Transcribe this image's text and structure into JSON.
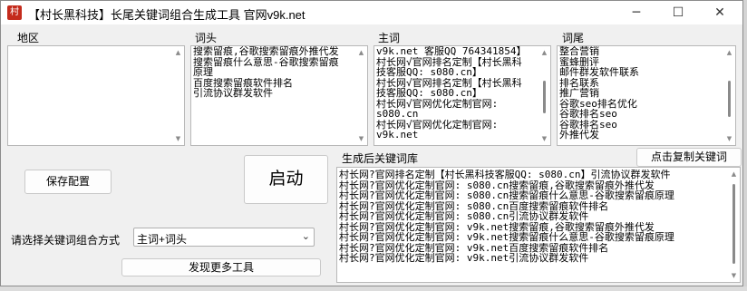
{
  "window": {
    "title": "【村长黑科技】长尾关键词组合生成工具   官网v9k.net",
    "icon_glyph": "村",
    "controls": [
      "minimize-icon",
      "maximize-icon",
      "close-icon"
    ]
  },
  "columns": {
    "region_label": "地区",
    "head_label": "词头",
    "main_label": "主词",
    "tail_label": "词尾"
  },
  "head_lines": [
    "搜索留痕,谷歌搜索留痕外推代发",
    "搜索留痕什么意思-谷歌搜索留痕",
    "原理",
    "百度搜索留痕软件排名",
    "引流协议群发软件"
  ],
  "main_lines": [
    "v9k.net 客服QQ 764341854】",
    "村长网√官网排名定制【村长黑科",
    "技客服QQ: s080.cn】",
    "村长网√官网排名定制【村长黑科",
    "技客服QQ: s080.cn】",
    "村长网√官网优化定制官网:",
    "s080.cn",
    "村长网√官网优化定制官网:",
    "v9k.net"
  ],
  "tail_lines": [
    "整合营销",
    "蜜蜂删评",
    "邮件群发软件联系",
    "排名联系",
    "推广营销",
    "谷歌seo排名优化",
    "谷歌排名seo",
    "谷歌排名seo",
    "外推代发"
  ],
  "buttons": {
    "save": "保存配置",
    "start": "启动",
    "copy": "点击复制关键词",
    "more": "发现更多工具"
  },
  "result": {
    "label": "生成后关键词库",
    "lines": [
      "村长网?官网排名定制【村长黑科技客服QQ: s080.cn】引流协议群发软件",
      "村长网?官网优化定制官网: s080.cn搜索留痕,谷歌搜索留痕外推代发",
      "村长网?官网优化定制官网: s080.cn搜索留痕什么意思-谷歌搜索留痕原理",
      "村长网?官网优化定制官网: s080.cn百度搜索留痕软件排名",
      "村长网?官网优化定制官网: s080.cn引流协议群发软件",
      "村长网?官网优化定制官网: v9k.net搜索留痕,谷歌搜索留痕外推代发",
      "村长网?官网优化定制官网: v9k.net搜索留痕什么意思-谷歌搜索留痕原理",
      "村长网?官网优化定制官网: v9k.net百度搜索留痕软件排名",
      "村长网?官网优化定制官网: v9k.net引流协议群发软件"
    ]
  },
  "combo": {
    "label": "请选择关键词组合方式",
    "value": "主词+词头"
  }
}
